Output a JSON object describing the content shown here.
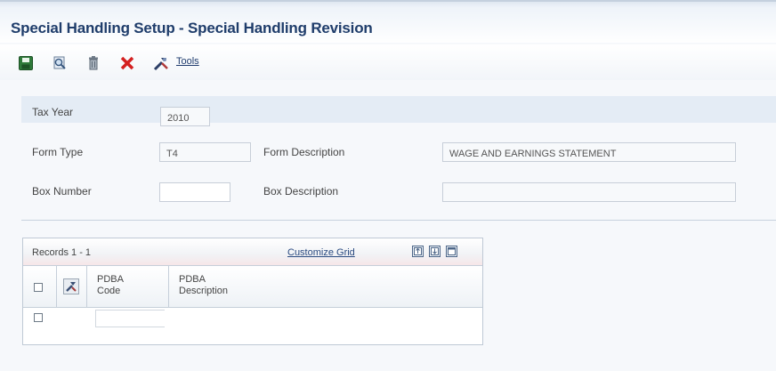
{
  "window": {
    "title": "Special Handling Setup - Special Handling Revision"
  },
  "toolbar": {
    "buttons": [
      {
        "name": "save-icon"
      },
      {
        "name": "find-icon"
      },
      {
        "name": "trash-icon"
      },
      {
        "name": "cancel-icon"
      },
      {
        "name": "tools-icon"
      }
    ],
    "tools_label": "Tools"
  },
  "form": {
    "tax_year_label": "Tax Year",
    "tax_year_value": "2010",
    "form_type_label": "Form Type",
    "form_type_value": "T4",
    "form_description_label": "Form Description",
    "form_description_value": "WAGE AND EARNINGS STATEMENT",
    "box_number_label": "Box Number",
    "box_number_value": "",
    "box_description_label": "Box Description",
    "box_description_value": ""
  },
  "grid": {
    "records_label": "Records 1 - 1",
    "customize_label": "Customize Grid",
    "icons": [
      "export-icon",
      "import-icon",
      "maximize-icon"
    ],
    "columns": [
      {
        "line1": "PDBA",
        "line2": "Code"
      },
      {
        "line1": "PDBA",
        "line2": "Description"
      }
    ],
    "rows": [
      {
        "pdba_code": "",
        "pdba_description": ""
      }
    ]
  },
  "colors": {
    "title": "#1f3d6b",
    "header_band": "#e4ecf5",
    "link": "#2a4a80",
    "cancel": "#d42020"
  }
}
